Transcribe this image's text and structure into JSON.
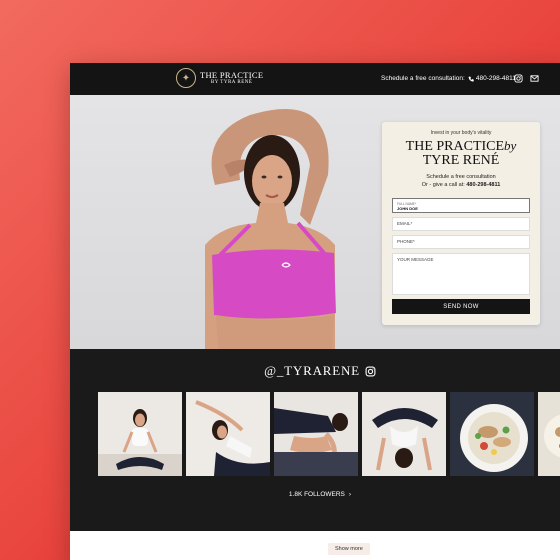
{
  "header": {
    "brand_main": "THE PRACTICE",
    "brand_sub": "BY TYRA RENÉ",
    "schedule_text": "Schedule a free consultation:",
    "phone": "480-298-4811",
    "icons": [
      "instagram-icon",
      "mail-icon"
    ]
  },
  "form": {
    "tagline": "Invest in your body's vitality",
    "title_line1": "THE PRACTICE",
    "title_by": "by",
    "title_line2": "TYRE RENÉ",
    "subtitle": "Schedule a free consultation",
    "call_prefix": "Or - give a call at:",
    "call_number": "480-298-4811",
    "fullname_label": "FULL NAME*",
    "fullname_value": "JOHN DOE",
    "email_placeholder": "EMAIL*",
    "phone_placeholder": "PHONE*",
    "message_placeholder": "YOUR MESSAGE",
    "send_label": "SEND NOW"
  },
  "instagram": {
    "handle": "@_TYRARENE",
    "followers": "1.8K FOLLOWERS",
    "thumbnails": [
      "yoga-seated",
      "yoga-side-stretch",
      "yoga-floor-pose",
      "yoga-backbend",
      "salad-bowl",
      "food-partial"
    ]
  },
  "footer": {
    "show_more": "Show more"
  },
  "colors": {
    "background": "#e8433c",
    "dark": "#141414",
    "form_bg": "#f3efe4",
    "accent_top": "#e040c8"
  }
}
